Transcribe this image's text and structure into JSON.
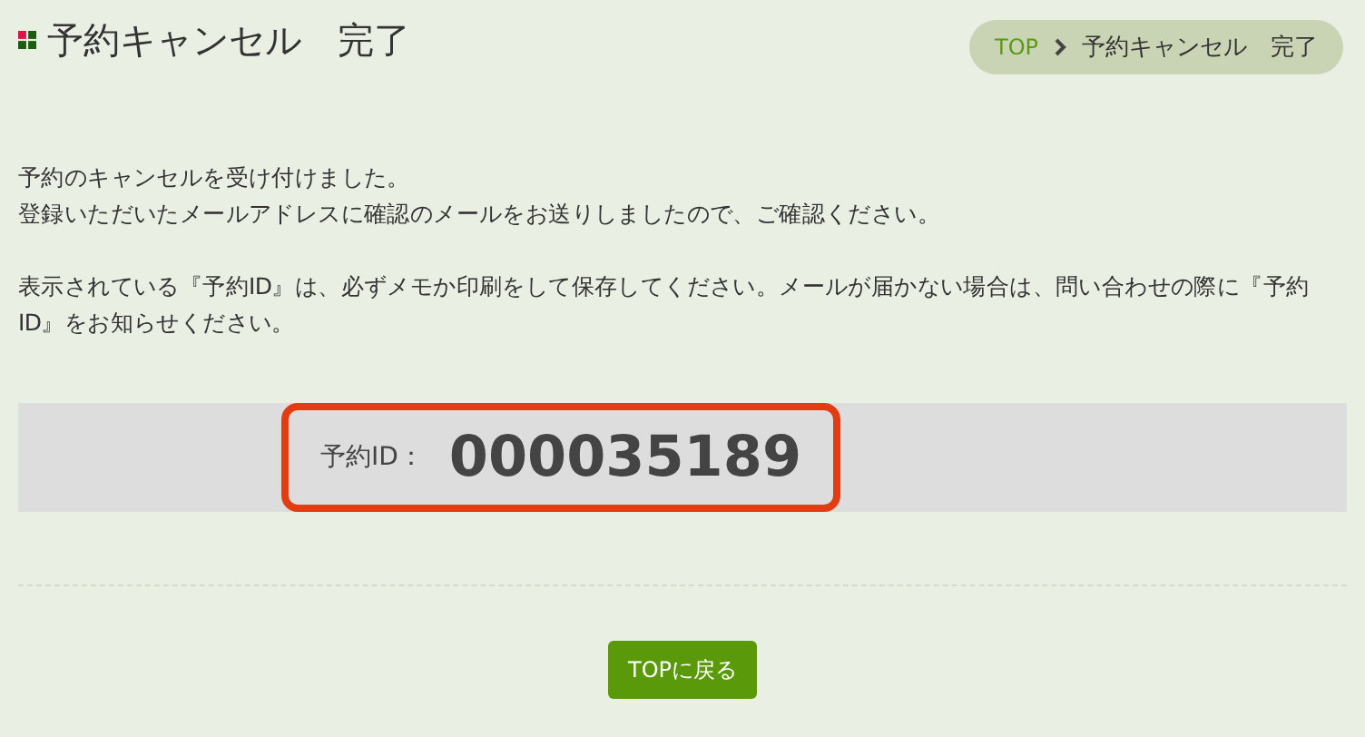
{
  "header": {
    "title": "予約キャンセル　完了"
  },
  "breadcrumb": [
    {
      "label": "TOP",
      "kind": "link"
    },
    {
      "label": "予約キャンセル　完了",
      "kind": "current"
    }
  ],
  "messages": [
    [
      "予約のキャンセルを受け付けました。",
      "登録いただいたメールアドレスに確認のメールをお送りしましたので、ご確認ください。"
    ],
    [
      "表示されている『予約ID』は、必ずメモか印刷をして保存してください。メールが届かない場合は、問い合わせの際に『予約ID』をお知らせください。"
    ]
  ],
  "reservation": {
    "label": "予約ID：",
    "value": "000035189"
  },
  "button": {
    "label": "TOPに戻る"
  }
}
